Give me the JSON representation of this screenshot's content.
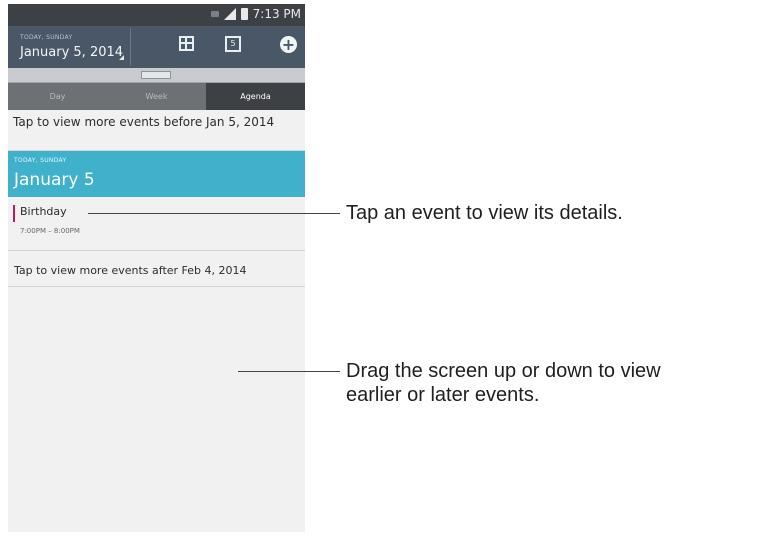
{
  "status_bar": {
    "time": "7:13 PM",
    "icons": [
      "notification-icon",
      "signal-icon",
      "battery-icon"
    ]
  },
  "action_bar": {
    "date_caption": "TODAY, SUNDAY",
    "date": "January 5, 2014",
    "icons": [
      "calendar-grid-icon",
      "today-icon",
      "add-event-icon"
    ],
    "today_icon_number": "5"
  },
  "tabs": [
    {
      "label": "Day",
      "active": false
    },
    {
      "label": "Week",
      "active": false
    },
    {
      "label": "Agenda",
      "active": true
    }
  ],
  "agenda": {
    "before_link": "Tap to view more events before Jan 5, 2014",
    "day_caption": "TODAY, SUNDAY",
    "day_title": "January 5",
    "event": {
      "title": "Birthday",
      "time": "7:00PM – 8:00PM",
      "color": "#b4205e"
    },
    "after_link": "Tap to view more events after Feb 4, 2014"
  },
  "callouts": {
    "event": "Tap an event to view its details.",
    "drag_line1": "Drag the screen up or down to view",
    "drag_line2": "earlier or later events."
  },
  "colors": {
    "action_bar": "#4a5766",
    "day_header": "#3fb1cb",
    "status_bar": "#3d4045"
  }
}
